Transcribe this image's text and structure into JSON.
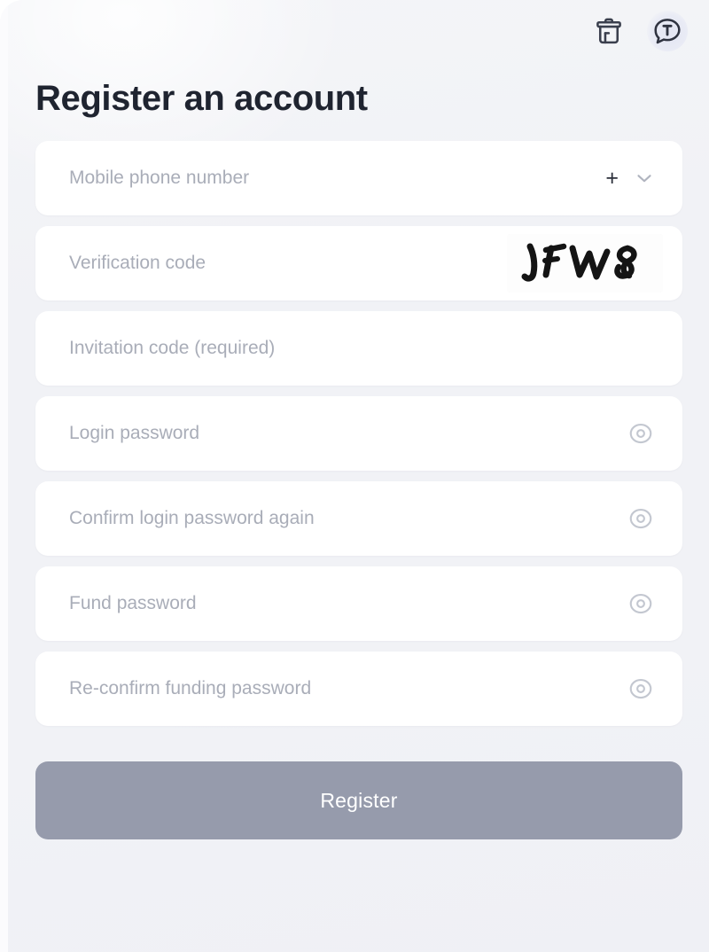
{
  "header": {
    "actions": [
      {
        "name": "delete-icon",
        "label": "Delete"
      },
      {
        "name": "translate-icon",
        "label": "Translate",
        "glyph": "T"
      }
    ]
  },
  "page": {
    "title": "Register an account"
  },
  "form": {
    "fields": [
      {
        "name": "mobile-phone-number",
        "placeholder": "Mobile phone number",
        "value": "",
        "type": "tel",
        "adornments": [
          "plus-sign",
          "chevron-down-icon"
        ],
        "plus_label": "+"
      },
      {
        "name": "verification-code",
        "placeholder": "Verification code",
        "value": "",
        "type": "text",
        "captcha_text": "JFW8"
      },
      {
        "name": "invitation-code",
        "placeholder": "Invitation code (required)",
        "value": "",
        "type": "text"
      },
      {
        "name": "login-password",
        "placeholder": "Login password",
        "value": "",
        "type": "password",
        "adornments": [
          "eye-icon"
        ]
      },
      {
        "name": "confirm-login-password",
        "placeholder": "Confirm login password again",
        "value": "",
        "type": "password",
        "adornments": [
          "eye-icon"
        ]
      },
      {
        "name": "fund-password",
        "placeholder": "Fund password",
        "value": "",
        "type": "password",
        "adornments": [
          "eye-icon"
        ]
      },
      {
        "name": "reconfirm-funding-password",
        "placeholder": "Re-confirm funding password",
        "value": "",
        "type": "password",
        "adornments": [
          "eye-icon"
        ]
      }
    ],
    "submit_label": "Register"
  },
  "colors": {
    "page_background": "#f1f2f6",
    "card_background": "#ffffff",
    "title_text": "#1f2430",
    "placeholder_text": "#a9adb8",
    "submit_background": "#969bac",
    "submit_text": "#ffffff",
    "icon_dark": "#3a3f4d",
    "icon_muted": "#b8bcc6"
  }
}
